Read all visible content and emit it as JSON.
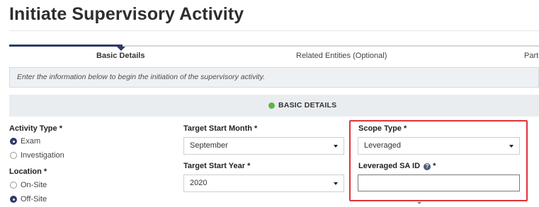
{
  "page": {
    "title": "Initiate Supervisory Activity"
  },
  "stepper": {
    "steps": [
      {
        "label": "Basic Details",
        "active": true
      },
      {
        "label": "Related Entities (Optional)",
        "active": false
      },
      {
        "label": "Part",
        "active": false
      }
    ],
    "active_color": "#2d3a66"
  },
  "info_banner": {
    "text": "Enter the information below to begin the initiation of the supervisory activity."
  },
  "section": {
    "title": "BASIC DETAILS",
    "status_color": "#5fb548"
  },
  "form": {
    "activity_type": {
      "label": "Activity Type *",
      "options": [
        {
          "label": "Exam",
          "checked": true
        },
        {
          "label": "Investigation",
          "checked": false
        }
      ]
    },
    "location": {
      "label": "Location *",
      "options": [
        {
          "label": "On-Site",
          "checked": false
        },
        {
          "label": "Off-Site",
          "checked": true
        }
      ]
    },
    "target_start_month": {
      "label": "Target Start Month *",
      "value": "September"
    },
    "target_start_year": {
      "label": "Target Start Year *",
      "value": "2020"
    },
    "scope_type": {
      "label": "Scope Type *",
      "value": "Leveraged"
    },
    "leveraged_sa_id": {
      "label": "Leveraged SA ID",
      "required_marker": "*",
      "help_icon": "question-circle-icon",
      "value": ""
    }
  },
  "highlight_color": "#e0323a"
}
